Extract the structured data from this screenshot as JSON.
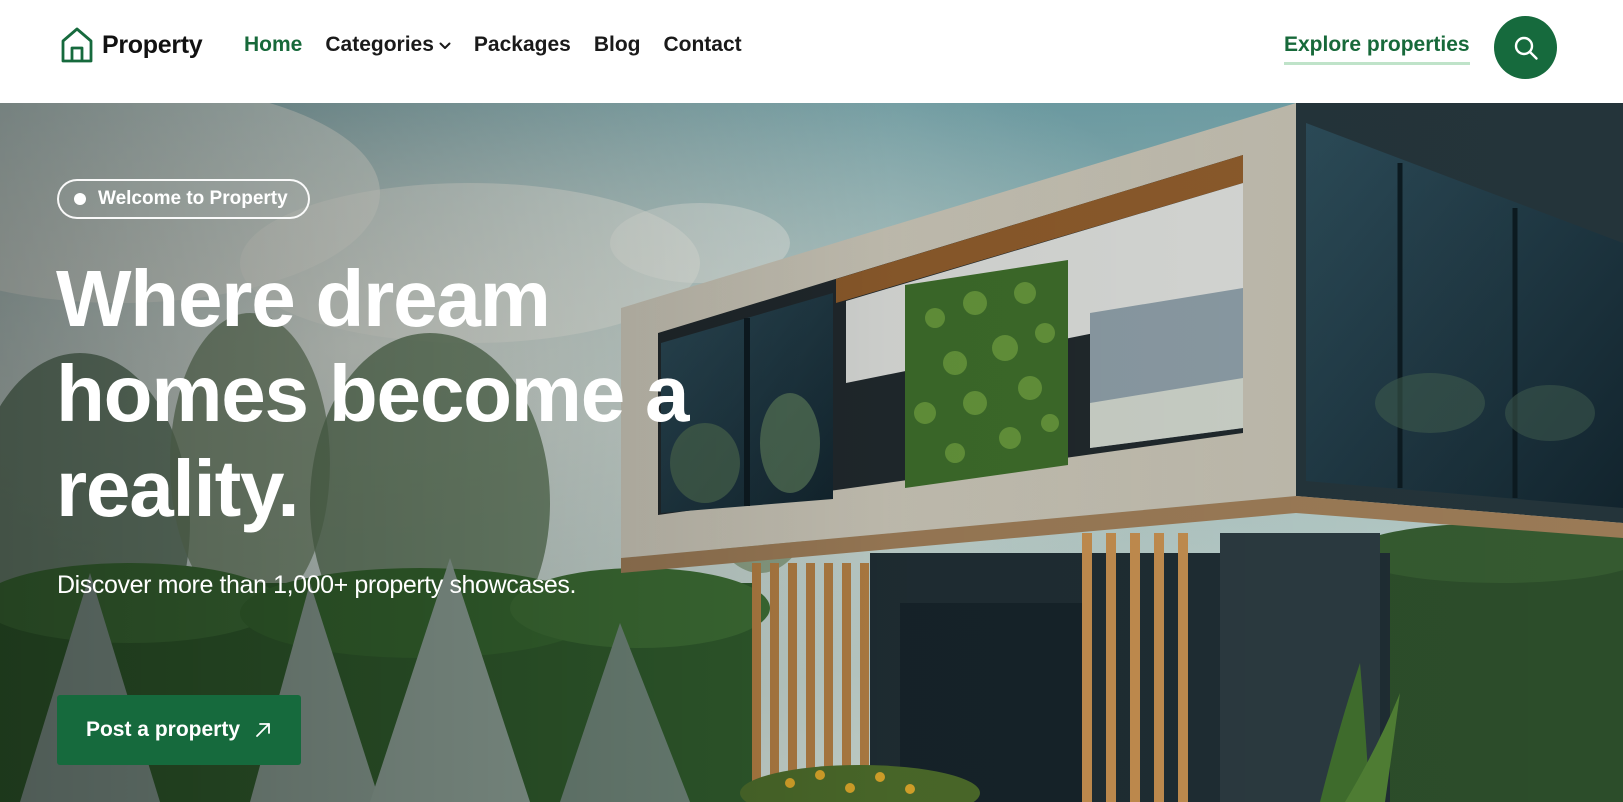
{
  "brand": {
    "name": "Property",
    "accent_color": "#166a3d",
    "icon": "house-outline-icon"
  },
  "nav": {
    "items": [
      {
        "label": "Home",
        "active": true
      },
      {
        "label": "Categories",
        "has_dropdown": true,
        "icon": "chevron-down-icon"
      },
      {
        "label": "Packages"
      },
      {
        "label": "Blog"
      },
      {
        "label": "Contact"
      }
    ],
    "explore_label": "Explore properties",
    "search_icon": "search-icon"
  },
  "hero": {
    "badge": "Welcome to Property",
    "heading_line1": "Where dream",
    "heading_line2": "homes become a",
    "heading_line3": "reality.",
    "subheading": "Discover more than 1,000+ property showcases.",
    "cta_label": "Post a property",
    "cta_icon": "arrow-up-right-icon",
    "background": "modern-house-photo"
  }
}
